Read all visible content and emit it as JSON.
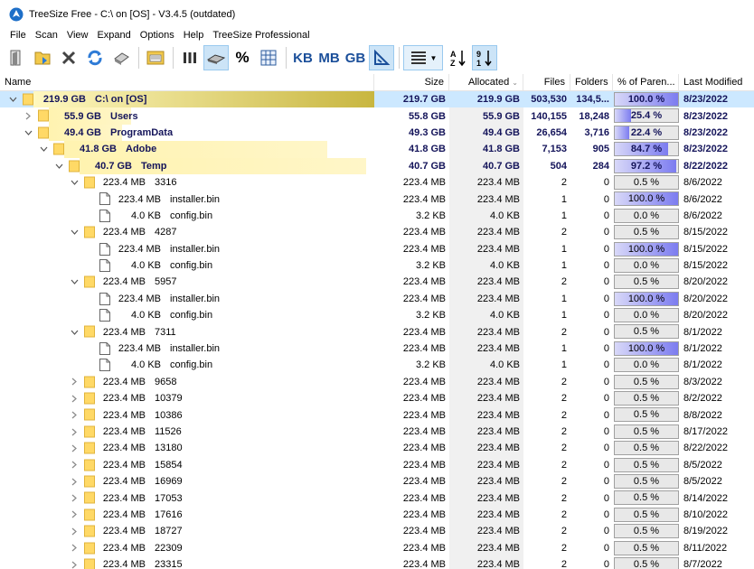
{
  "window": {
    "title": "TreeSize Free - C:\\  on  [OS] - V3.4.5 (outdated)"
  },
  "menu": [
    "File",
    "Scan",
    "View",
    "Expand",
    "Options",
    "Help",
    "TreeSize Professional"
  ],
  "toolbar": {
    "buttons": [
      "open-folder-icon",
      "scan-folder-icon",
      "stop-icon",
      "refresh-icon",
      "print-icon",
      "export-icon",
      "bar-view-icon",
      "drive-icon",
      "percent-icon",
      "grid-icon",
      "kb-unit",
      "mb-unit",
      "gb-unit",
      "auto-unit-icon",
      "list-view-icon",
      "sort-az-icon",
      "sort-size-icon"
    ],
    "kb_label": "KB",
    "mb_label": "MB",
    "gb_label": "GB",
    "pct_label": "%"
  },
  "columns": {
    "name": "Name",
    "size": "Size",
    "allocated": "Allocated",
    "files": "Files",
    "folders": "Folders",
    "pct": "% of Paren...",
    "modified": "Last Modified"
  },
  "colors": {
    "selected_row": "#cce8ff",
    "name_bar": "#fff4b0",
    "pct_fill": "#7c7cf0",
    "folder": "#ffd966"
  },
  "rows": [
    {
      "level": 0,
      "expand": "open",
      "type": "folder",
      "size_label": "219.9 GB",
      "name": "C:\\  on  [OS]",
      "size": "219.7 GB",
      "allocated": "219.9 GB",
      "files": "503,530",
      "folders": "134,5...",
      "pct": "100.0 %",
      "pct_value": 100,
      "modified": "8/23/2022",
      "bold": true,
      "selected": true,
      "bar": 1.0
    },
    {
      "level": 1,
      "expand": "closed",
      "type": "folder",
      "size_label": "55.9 GB",
      "name": "Users",
      "size": "55.8 GB",
      "allocated": "55.9 GB",
      "files": "140,155",
      "folders": "18,248",
      "pct": "25.4 %",
      "pct_value": 25.4,
      "modified": "8/23/2022",
      "bold": true,
      "selected": false,
      "bar": 0.254
    },
    {
      "level": 1,
      "expand": "open",
      "type": "folder",
      "size_label": "49.4 GB",
      "name": "ProgramData",
      "size": "49.3 GB",
      "allocated": "49.4 GB",
      "files": "26,654",
      "folders": "3,716",
      "pct": "22.4 %",
      "pct_value": 22.4,
      "modified": "8/23/2022",
      "bold": true,
      "selected": false,
      "bar": 0.224
    },
    {
      "level": 2,
      "expand": "open",
      "type": "folder",
      "size_label": "41.8 GB",
      "name": "Adobe",
      "size": "41.8 GB",
      "allocated": "41.8 GB",
      "files": "7,153",
      "folders": "905",
      "pct": "84.7 %",
      "pct_value": 84.7,
      "modified": "8/23/2022",
      "bold": true,
      "selected": false,
      "bar": 0.847
    },
    {
      "level": 3,
      "expand": "open",
      "type": "folder",
      "size_label": "40.7 GB",
      "name": "Temp",
      "size": "40.7 GB",
      "allocated": "40.7 GB",
      "files": "504",
      "folders": "284",
      "pct": "97.2 %",
      "pct_value": 97.2,
      "modified": "8/22/2022",
      "bold": true,
      "selected": false,
      "bar": 0.972
    },
    {
      "level": 4,
      "expand": "open",
      "type": "folder",
      "size_label": "223.4 MB",
      "name": "3316",
      "size": "223.4 MB",
      "allocated": "223.4 MB",
      "files": "2",
      "folders": "0",
      "pct": "0.5 %",
      "pct_value": 0.5,
      "modified": "8/6/2022",
      "bold": false,
      "selected": false,
      "bar": 0
    },
    {
      "level": 5,
      "expand": "none",
      "type": "file",
      "size_label": "223.4 MB",
      "name": "installer.bin",
      "size": "223.4 MB",
      "allocated": "223.4 MB",
      "files": "1",
      "folders": "0",
      "pct": "100.0 %",
      "pct_value": 100,
      "modified": "8/6/2022",
      "bold": false,
      "selected": false,
      "bar": 0
    },
    {
      "level": 5,
      "expand": "none",
      "type": "file",
      "size_label": "4.0 KB",
      "name": "config.bin",
      "size": "3.2 KB",
      "allocated": "4.0 KB",
      "files": "1",
      "folders": "0",
      "pct": "0.0 %",
      "pct_value": 0,
      "modified": "8/6/2022",
      "bold": false,
      "selected": false,
      "bar": 0
    },
    {
      "level": 4,
      "expand": "open",
      "type": "folder",
      "size_label": "223.4 MB",
      "name": "4287",
      "size": "223.4 MB",
      "allocated": "223.4 MB",
      "files": "2",
      "folders": "0",
      "pct": "0.5 %",
      "pct_value": 0.5,
      "modified": "8/15/2022",
      "bold": false,
      "selected": false,
      "bar": 0
    },
    {
      "level": 5,
      "expand": "none",
      "type": "file",
      "size_label": "223.4 MB",
      "name": "installer.bin",
      "size": "223.4 MB",
      "allocated": "223.4 MB",
      "files": "1",
      "folders": "0",
      "pct": "100.0 %",
      "pct_value": 100,
      "modified": "8/15/2022",
      "bold": false,
      "selected": false,
      "bar": 0
    },
    {
      "level": 5,
      "expand": "none",
      "type": "file",
      "size_label": "4.0 KB",
      "name": "config.bin",
      "size": "3.2 KB",
      "allocated": "4.0 KB",
      "files": "1",
      "folders": "0",
      "pct": "0.0 %",
      "pct_value": 0,
      "modified": "8/15/2022",
      "bold": false,
      "selected": false,
      "bar": 0
    },
    {
      "level": 4,
      "expand": "open",
      "type": "folder",
      "size_label": "223.4 MB",
      "name": "5957",
      "size": "223.4 MB",
      "allocated": "223.4 MB",
      "files": "2",
      "folders": "0",
      "pct": "0.5 %",
      "pct_value": 0.5,
      "modified": "8/20/2022",
      "bold": false,
      "selected": false,
      "bar": 0
    },
    {
      "level": 5,
      "expand": "none",
      "type": "file",
      "size_label": "223.4 MB",
      "name": "installer.bin",
      "size": "223.4 MB",
      "allocated": "223.4 MB",
      "files": "1",
      "folders": "0",
      "pct": "100.0 %",
      "pct_value": 100,
      "modified": "8/20/2022",
      "bold": false,
      "selected": false,
      "bar": 0
    },
    {
      "level": 5,
      "expand": "none",
      "type": "file",
      "size_label": "4.0 KB",
      "name": "config.bin",
      "size": "3.2 KB",
      "allocated": "4.0 KB",
      "files": "1",
      "folders": "0",
      "pct": "0.0 %",
      "pct_value": 0,
      "modified": "8/20/2022",
      "bold": false,
      "selected": false,
      "bar": 0
    },
    {
      "level": 4,
      "expand": "open",
      "type": "folder",
      "size_label": "223.4 MB",
      "name": "7311",
      "size": "223.4 MB",
      "allocated": "223.4 MB",
      "files": "2",
      "folders": "0",
      "pct": "0.5 %",
      "pct_value": 0.5,
      "modified": "8/1/2022",
      "bold": false,
      "selected": false,
      "bar": 0
    },
    {
      "level": 5,
      "expand": "none",
      "type": "file",
      "size_label": "223.4 MB",
      "name": "installer.bin",
      "size": "223.4 MB",
      "allocated": "223.4 MB",
      "files": "1",
      "folders": "0",
      "pct": "100.0 %",
      "pct_value": 100,
      "modified": "8/1/2022",
      "bold": false,
      "selected": false,
      "bar": 0
    },
    {
      "level": 5,
      "expand": "none",
      "type": "file",
      "size_label": "4.0 KB",
      "name": "config.bin",
      "size": "3.2 KB",
      "allocated": "4.0 KB",
      "files": "1",
      "folders": "0",
      "pct": "0.0 %",
      "pct_value": 0,
      "modified": "8/1/2022",
      "bold": false,
      "selected": false,
      "bar": 0
    },
    {
      "level": 4,
      "expand": "closed",
      "type": "folder",
      "size_label": "223.4 MB",
      "name": "9658",
      "size": "223.4 MB",
      "allocated": "223.4 MB",
      "files": "2",
      "folders": "0",
      "pct": "0.5 %",
      "pct_value": 0.5,
      "modified": "8/3/2022",
      "bold": false,
      "selected": false,
      "bar": 0
    },
    {
      "level": 4,
      "expand": "closed",
      "type": "folder",
      "size_label": "223.4 MB",
      "name": "10379",
      "size": "223.4 MB",
      "allocated": "223.4 MB",
      "files": "2",
      "folders": "0",
      "pct": "0.5 %",
      "pct_value": 0.5,
      "modified": "8/2/2022",
      "bold": false,
      "selected": false,
      "bar": 0
    },
    {
      "level": 4,
      "expand": "closed",
      "type": "folder",
      "size_label": "223.4 MB",
      "name": "10386",
      "size": "223.4 MB",
      "allocated": "223.4 MB",
      "files": "2",
      "folders": "0",
      "pct": "0.5 %",
      "pct_value": 0.5,
      "modified": "8/8/2022",
      "bold": false,
      "selected": false,
      "bar": 0
    },
    {
      "level": 4,
      "expand": "closed",
      "type": "folder",
      "size_label": "223.4 MB",
      "name": "11526",
      "size": "223.4 MB",
      "allocated": "223.4 MB",
      "files": "2",
      "folders": "0",
      "pct": "0.5 %",
      "pct_value": 0.5,
      "modified": "8/17/2022",
      "bold": false,
      "selected": false,
      "bar": 0
    },
    {
      "level": 4,
      "expand": "closed",
      "type": "folder",
      "size_label": "223.4 MB",
      "name": "13180",
      "size": "223.4 MB",
      "allocated": "223.4 MB",
      "files": "2",
      "folders": "0",
      "pct": "0.5 %",
      "pct_value": 0.5,
      "modified": "8/22/2022",
      "bold": false,
      "selected": false,
      "bar": 0
    },
    {
      "level": 4,
      "expand": "closed",
      "type": "folder",
      "size_label": "223.4 MB",
      "name": "15854",
      "size": "223.4 MB",
      "allocated": "223.4 MB",
      "files": "2",
      "folders": "0",
      "pct": "0.5 %",
      "pct_value": 0.5,
      "modified": "8/5/2022",
      "bold": false,
      "selected": false,
      "bar": 0
    },
    {
      "level": 4,
      "expand": "closed",
      "type": "folder",
      "size_label": "223.4 MB",
      "name": "16969",
      "size": "223.4 MB",
      "allocated": "223.4 MB",
      "files": "2",
      "folders": "0",
      "pct": "0.5 %",
      "pct_value": 0.5,
      "modified": "8/5/2022",
      "bold": false,
      "selected": false,
      "bar": 0
    },
    {
      "level": 4,
      "expand": "closed",
      "type": "folder",
      "size_label": "223.4 MB",
      "name": "17053",
      "size": "223.4 MB",
      "allocated": "223.4 MB",
      "files": "2",
      "folders": "0",
      "pct": "0.5 %",
      "pct_value": 0.5,
      "modified": "8/14/2022",
      "bold": false,
      "selected": false,
      "bar": 0
    },
    {
      "level": 4,
      "expand": "closed",
      "type": "folder",
      "size_label": "223.4 MB",
      "name": "17616",
      "size": "223.4 MB",
      "allocated": "223.4 MB",
      "files": "2",
      "folders": "0",
      "pct": "0.5 %",
      "pct_value": 0.5,
      "modified": "8/10/2022",
      "bold": false,
      "selected": false,
      "bar": 0
    },
    {
      "level": 4,
      "expand": "closed",
      "type": "folder",
      "size_label": "223.4 MB",
      "name": "18727",
      "size": "223.4 MB",
      "allocated": "223.4 MB",
      "files": "2",
      "folders": "0",
      "pct": "0.5 %",
      "pct_value": 0.5,
      "modified": "8/19/2022",
      "bold": false,
      "selected": false,
      "bar": 0
    },
    {
      "level": 4,
      "expand": "closed",
      "type": "folder",
      "size_label": "223.4 MB",
      "name": "22309",
      "size": "223.4 MB",
      "allocated": "223.4 MB",
      "files": "2",
      "folders": "0",
      "pct": "0.5 %",
      "pct_value": 0.5,
      "modified": "8/11/2022",
      "bold": false,
      "selected": false,
      "bar": 0
    },
    {
      "level": 4,
      "expand": "closed",
      "type": "folder",
      "size_label": "223.4 MB",
      "name": "23315",
      "size": "223.4 MB",
      "allocated": "223.4 MB",
      "files": "2",
      "folders": "0",
      "pct": "0.5 %",
      "pct_value": 0.5,
      "modified": "8/7/2022",
      "bold": false,
      "selected": false,
      "bar": 0
    }
  ]
}
